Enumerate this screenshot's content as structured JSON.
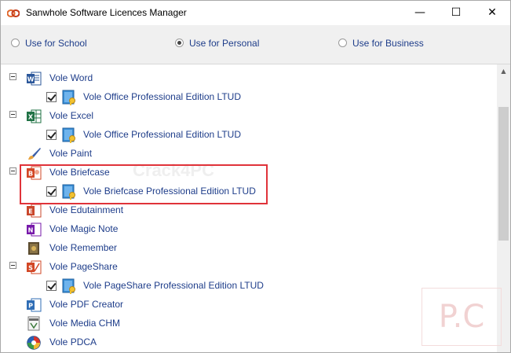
{
  "window": {
    "title": "Sanwhole Software Licences Manager",
    "minimize_glyph": "—",
    "maximize_glyph": "☐",
    "close_glyph": "✕"
  },
  "usage_mode": {
    "options": [
      {
        "label": "Use for School",
        "selected": false
      },
      {
        "label": "Use for Personal",
        "selected": true
      },
      {
        "label": "Use for Business",
        "selected": false
      }
    ]
  },
  "tree": {
    "items": [
      {
        "label": "Vole Word",
        "icon": "word-icon",
        "expanded": true
      },
      {
        "label": "Vole Office Professional Edition LTUD",
        "icon": "license-icon",
        "checked": true
      },
      {
        "label": "Vole Excel",
        "icon": "excel-icon",
        "expanded": true
      },
      {
        "label": "Vole Office Professional Edition LTUD",
        "icon": "license-icon",
        "checked": true
      },
      {
        "label": "Vole Paint",
        "icon": "paint-brush-icon"
      },
      {
        "label": "Vole Briefcase",
        "icon": "briefcase-icon",
        "expanded": true
      },
      {
        "label": "Vole Briefcase Professional Edition LTUD",
        "icon": "license-icon",
        "checked": true
      },
      {
        "label": "Vole Edutainment",
        "icon": "edutainment-icon"
      },
      {
        "label": "Vole Magic Note",
        "icon": "magic-note-icon"
      },
      {
        "label": "Vole Remember",
        "icon": "remember-icon"
      },
      {
        "label": "Vole PageShare",
        "icon": "pageshare-icon",
        "expanded": true
      },
      {
        "label": "Vole PageShare Professional Edition LTUD",
        "icon": "license-icon",
        "checked": true
      },
      {
        "label": "Vole PDF Creator",
        "icon": "pdf-creator-icon"
      },
      {
        "label": "Vole Media CHM",
        "icon": "media-chm-icon"
      },
      {
        "label": "Vole PDCA",
        "icon": "pdca-icon"
      }
    ]
  },
  "watermark": {
    "text": "P.C",
    "text2": "Crack4PC"
  },
  "colors": {
    "highlight": "#e0333a",
    "label": "#1e3d8a",
    "header_bg": "#f0f0f0"
  }
}
